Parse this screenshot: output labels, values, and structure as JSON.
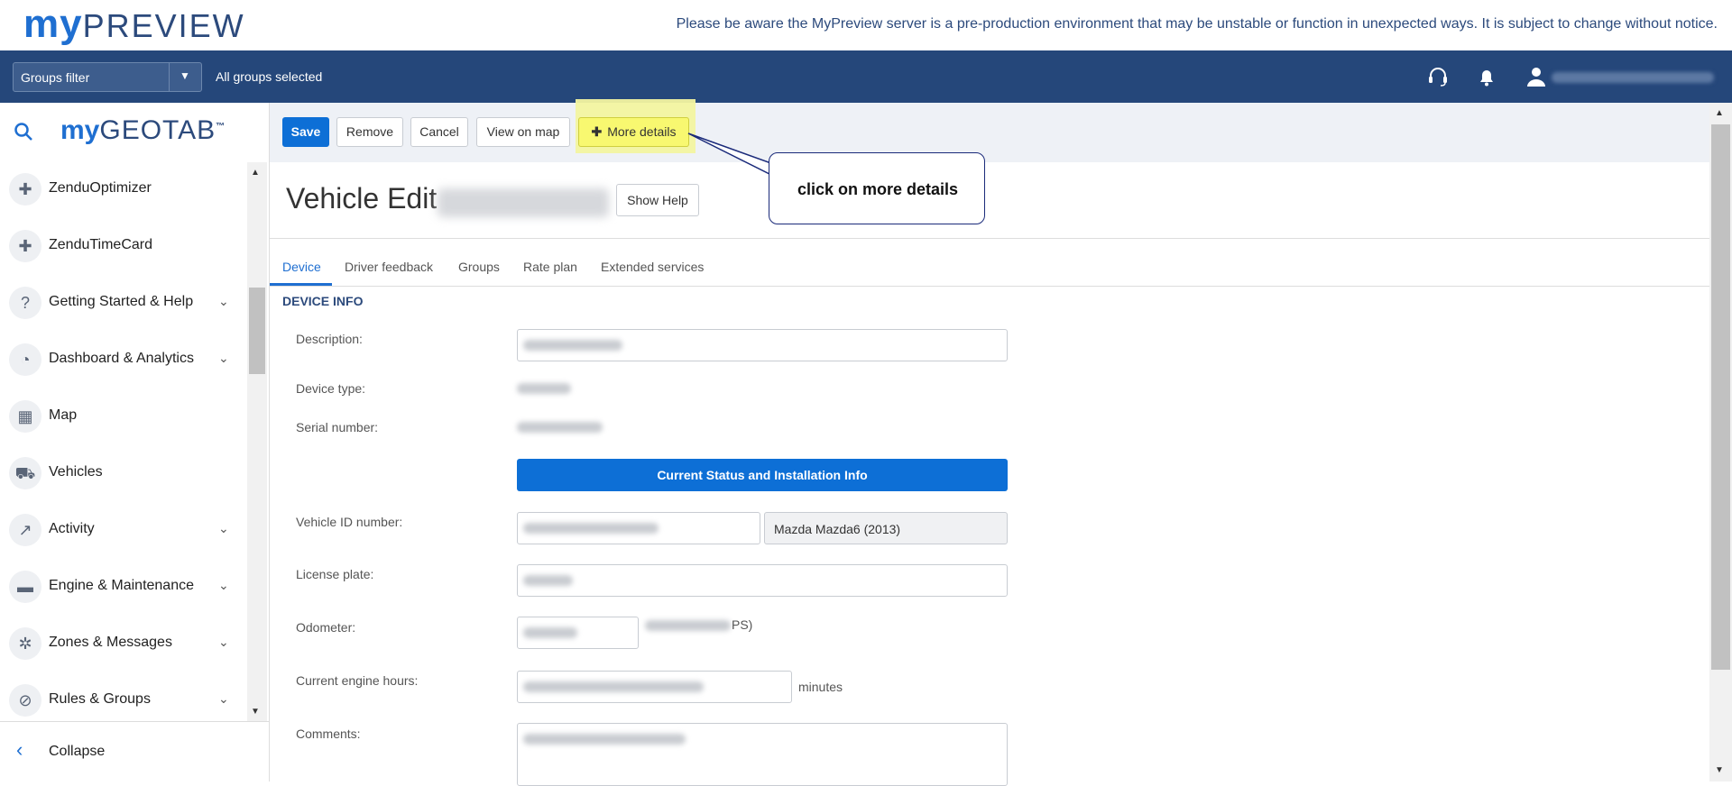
{
  "header": {
    "logo_my": "my",
    "logo_preview": "PREVIEW",
    "notice": "Please be aware the MyPreview server is a pre-production environment that may be unstable or function in unexpected ways. It is subject to change without notice."
  },
  "navbar": {
    "groups_filter": "Groups filter",
    "groups_status": "All groups selected"
  },
  "sidebar": {
    "logo_my": "my",
    "logo_geo": "GEOTAB",
    "logo_tm": "™",
    "items": [
      {
        "label": "ZenduOptimizer",
        "icon": "puzzle-icon",
        "expandable": false
      },
      {
        "label": "ZenduTimeCard",
        "icon": "puzzle-icon",
        "expandable": false
      },
      {
        "label": "Getting Started & Help",
        "icon": "help-icon",
        "expandable": true
      },
      {
        "label": "Dashboard & Analytics",
        "icon": "pie-chart-icon",
        "expandable": true
      },
      {
        "label": "Map",
        "icon": "map-icon",
        "expandable": false
      },
      {
        "label": "Vehicles",
        "icon": "truck-icon",
        "expandable": false
      },
      {
        "label": "Activity",
        "icon": "activity-chart-icon",
        "expandable": true
      },
      {
        "label": "Engine & Maintenance",
        "icon": "engine-icon",
        "expandable": true
      },
      {
        "label": "Zones & Messages",
        "icon": "zones-icon",
        "expandable": true
      },
      {
        "label": "Rules & Groups",
        "icon": "rules-icon",
        "expandable": true
      }
    ],
    "collapse_label": "Collapse"
  },
  "toolbar": {
    "save": "Save",
    "remove": "Remove",
    "cancel": "Cancel",
    "view_on_map": "View on map",
    "more_details": "More details"
  },
  "page": {
    "title": "Vehicle Edit",
    "show_help": "Show Help"
  },
  "callout": {
    "text": "click on more details"
  },
  "tabs": [
    {
      "label": "Device",
      "active": true
    },
    {
      "label": "Driver feedback",
      "active": false
    },
    {
      "label": "Groups",
      "active": false
    },
    {
      "label": "Rate plan",
      "active": false
    },
    {
      "label": "Extended services",
      "active": false
    }
  ],
  "device_info": {
    "section_title": "DEVICE INFO",
    "description_label": "Description:",
    "device_type_label": "Device type:",
    "serial_number_label": "Serial number:",
    "status_button": "Current Status and Installation Info",
    "vin_label": "Vehicle ID number:",
    "vehicle_model": "Mazda Mazda6 (2013)",
    "license_plate_label": "License plate:",
    "odometer_label": "Odometer:",
    "odometer_suffix": "PS)",
    "engine_hours_label": "Current engine hours:",
    "engine_hours_unit": "minutes",
    "comments_label": "Comments:"
  },
  "colors": {
    "navbar": "#25477a",
    "primary": "#0d6fd6",
    "highlight": "#f8f870"
  }
}
